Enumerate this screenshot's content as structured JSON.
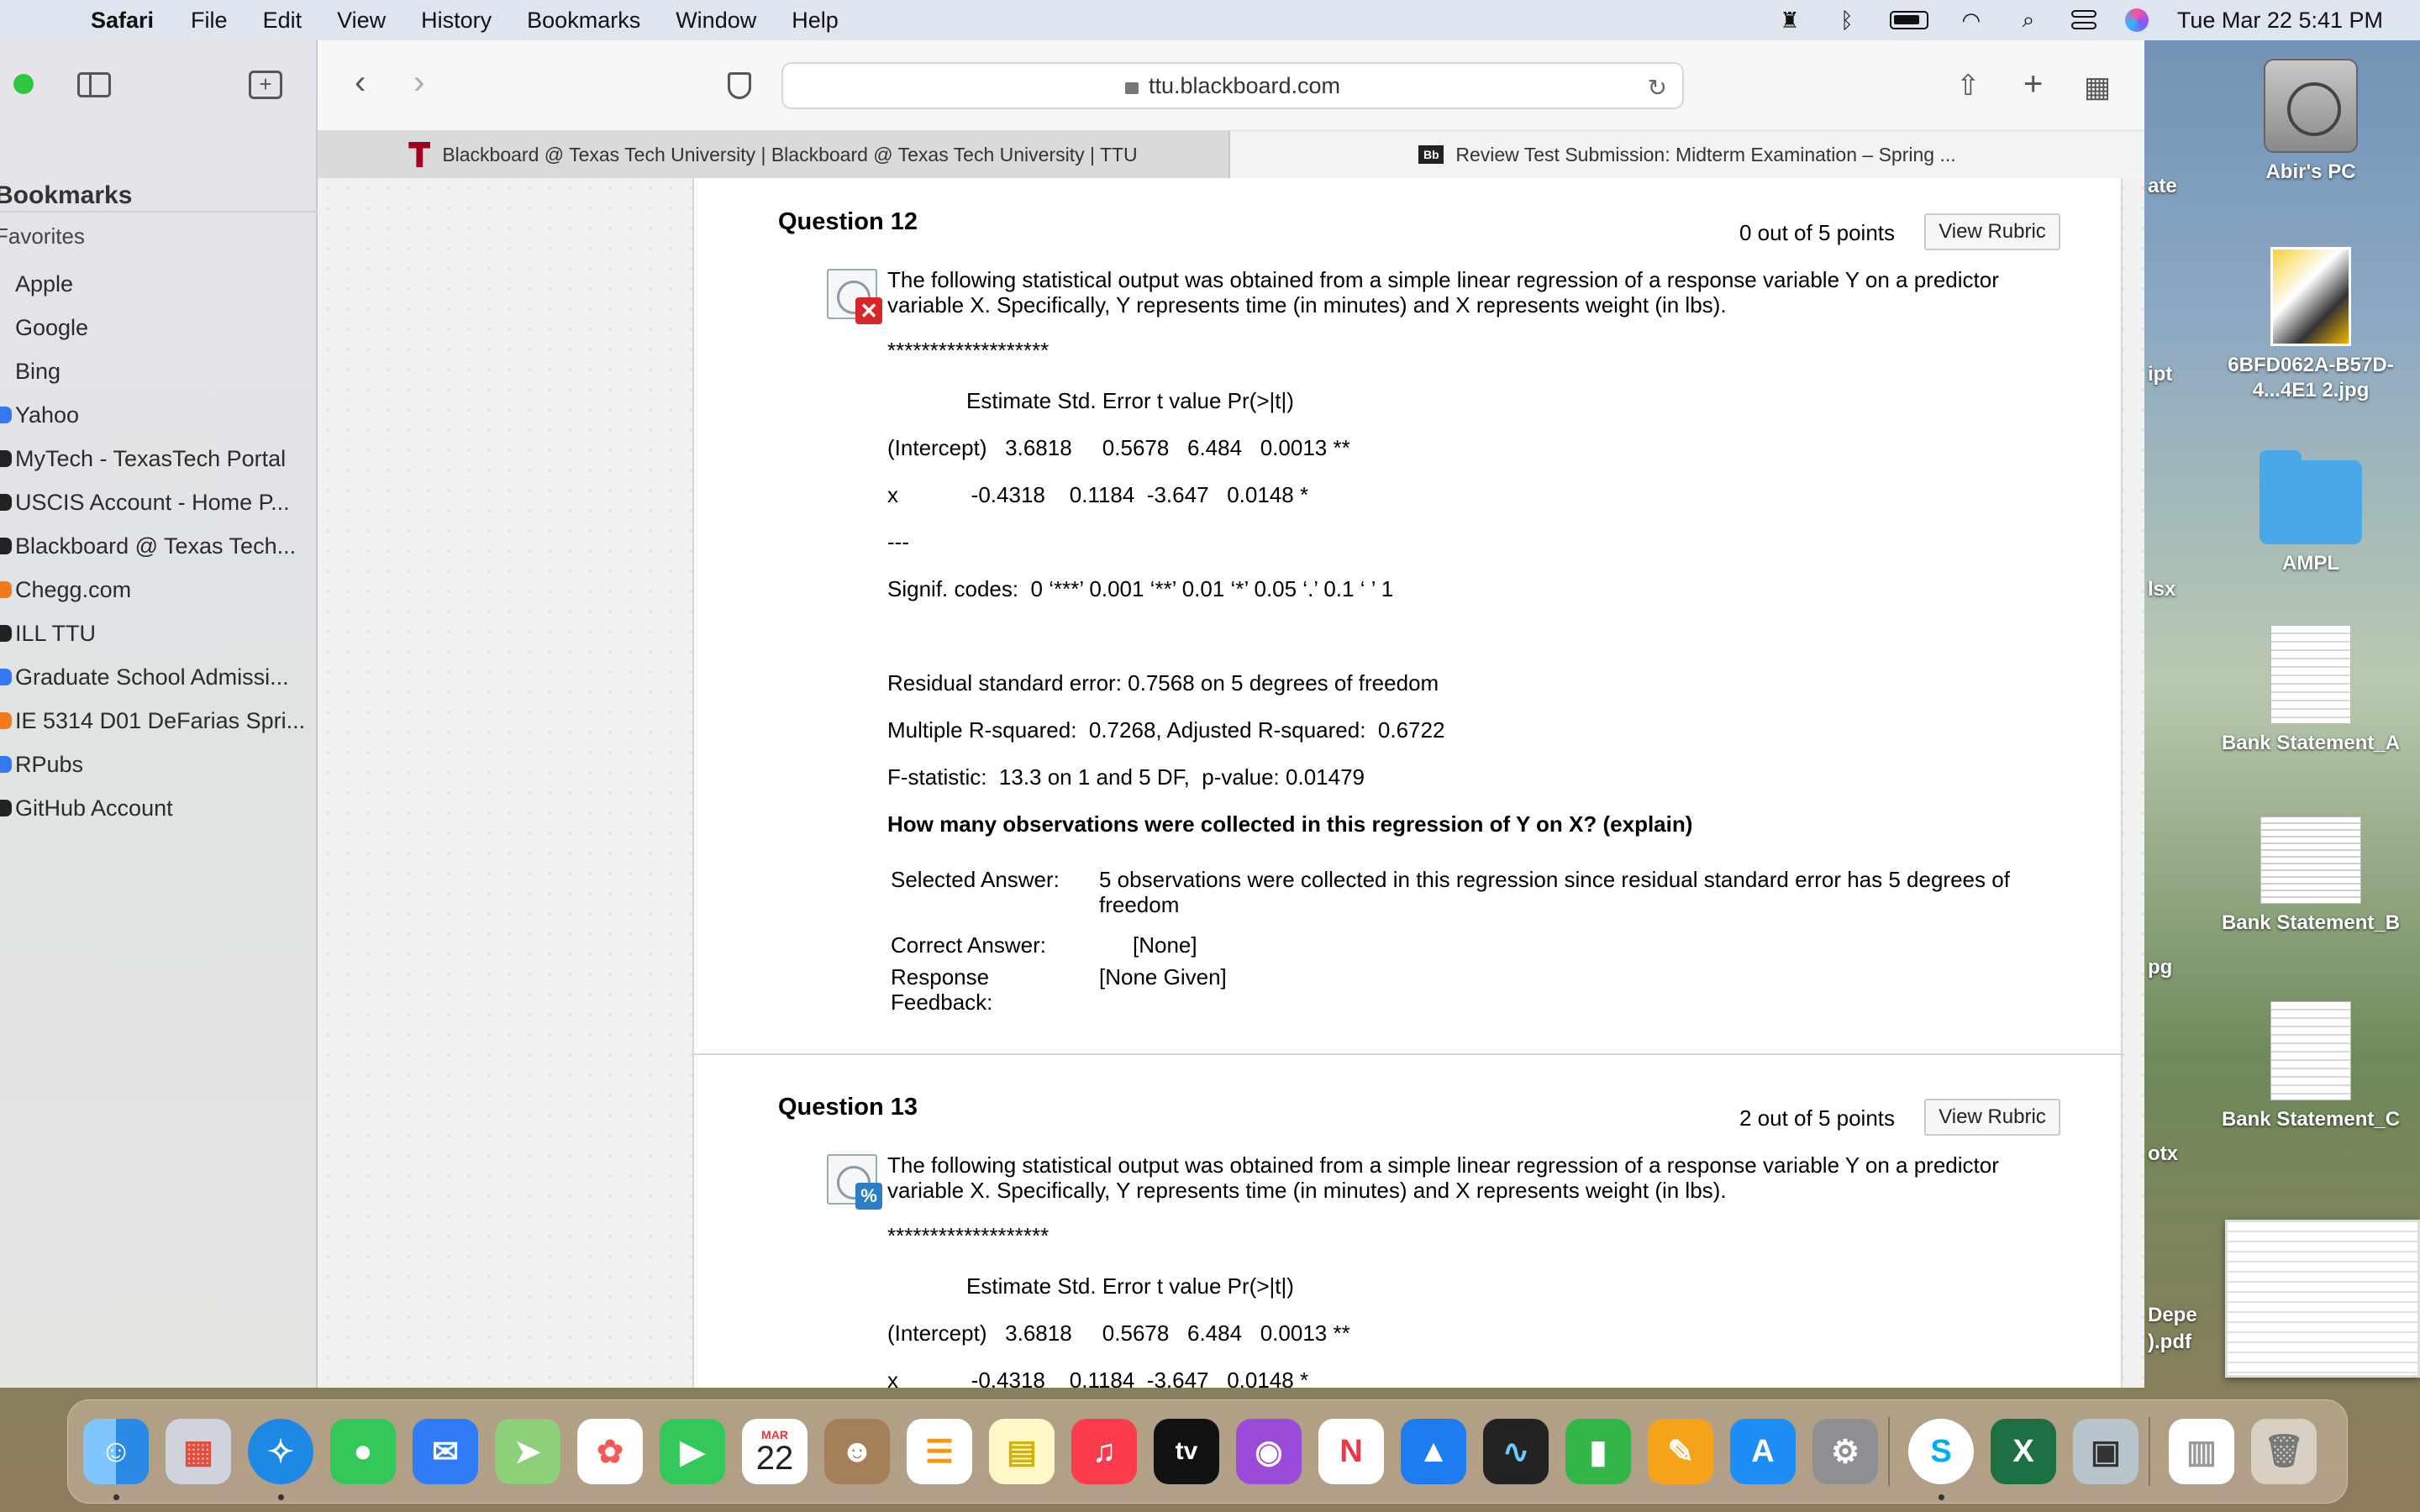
{
  "menubar": {
    "app": "Safari",
    "items": [
      "File",
      "Edit",
      "View",
      "History",
      "Bookmarks",
      "Window",
      "Help"
    ],
    "clock": "Tue Mar 22  5:41 PM"
  },
  "sidebar": {
    "heading": "Bookmarks",
    "favorites_label": "Favorites",
    "items": [
      {
        "label": "Apple",
        "color": ""
      },
      {
        "label": "Google",
        "color": ""
      },
      {
        "label": "Bing",
        "color": ""
      },
      {
        "label": "Yahoo",
        "color": "#3478f6"
      },
      {
        "label": "MyTech - TexasTech Portal",
        "color": "#222222"
      },
      {
        "label": "USCIS Account - Home P...",
        "color": "#222222"
      },
      {
        "label": "Blackboard @ Texas Tech...",
        "color": "#222222"
      },
      {
        "label": "Chegg.com",
        "color": "#f27a1a"
      },
      {
        "label": "ILL TTU",
        "color": "#222222"
      },
      {
        "label": "Graduate School Admissi...",
        "color": "#3478f6"
      },
      {
        "label": "IE 5314 D01 DeFarias Spri...",
        "color": "#f27a1a"
      },
      {
        "label": "RPubs",
        "color": "#3478f6"
      },
      {
        "label": "GitHub Account",
        "color": "#222222"
      }
    ]
  },
  "toolbar": {
    "url": "ttu.blackboard.com"
  },
  "tabs": [
    {
      "label": "Blackboard @ Texas Tech University | Blackboard @ Texas Tech University | TTU"
    },
    {
      "label": "Review Test Submission: Midterm Examination – Spring ...",
      "favicon": "Bb"
    }
  ],
  "q12": {
    "title": "Question 12",
    "points": "0 out of 5 points",
    "rubric": "View Rubric",
    "intro": "The following statistical output was obtained from a simple linear regression of a response variable Y on a predictor variable X.  Specifically, Y represents time (in minutes) and X represents weight (in lbs).",
    "stars": "*******************",
    "header": "Estimate Std. Error t value Pr(>|t|)",
    "row_intercept": "(Intercept)   3.6818     0.5678   6.484   0.0013 **",
    "row_x": "x            -0.4318    0.1184  -3.647   0.0148 *",
    "dashes": "---",
    "signif": "Signif. codes:  0 ‘***’ 0.001 ‘**’ 0.01 ‘*’ 0.05 ‘.’ 0.1 ‘ ’ 1",
    "rse": "Residual standard error: 0.7568 on 5 degrees of freedom",
    "r2": "Multiple R-squared:  0.7268, Adjusted R-squared:  0.6722",
    "fstat": "F-statistic:  13.3 on 1 and 5 DF,  p-value: 0.01479",
    "prompt": "How many observations were collected in this regression of Y on X? (explain)",
    "selected_label": "Selected Answer:",
    "selected_value": "5 observations were collected in this regression since residual standard error has 5 degrees of freedom",
    "correct_label": "Correct Answer:",
    "correct_value": "[None]",
    "feedback_label": "Response Feedback:",
    "feedback_value": "[None Given]"
  },
  "q13": {
    "title": "Question 13",
    "points": "2 out of 5 points",
    "rubric": "View Rubric",
    "intro": "The following statistical output was obtained from a simple linear regression of a response variable Y on a predictor variable X.  Specifically, Y represents time (in minutes) and X represents weight (in lbs).",
    "stars": "*******************",
    "header": "Estimate Std. Error t value Pr(>|t|)",
    "row_intercept": "(Intercept)   3.6818     0.5678   6.484   0.0013 **",
    "row_x": "x            -0.4318    0.1184  -3.647   0.0148 *"
  },
  "desktop": {
    "items": [
      {
        "label": "Abir's PC"
      },
      {
        "label": "6BFD062A-B57D-4...4E1 2.jpg"
      },
      {
        "label": "AMPL"
      },
      {
        "label": "Bank Statement_A"
      },
      {
        "label": "Bank Statement_B"
      },
      {
        "label": "Bank Statement_C"
      }
    ],
    "clipped": [
      "ate",
      "ipt",
      "lsx",
      "pg",
      "otx",
      "Depe",
      ").pdf"
    ]
  },
  "dock": {
    "calendar_month": "MAR",
    "calendar_day": "22",
    "tv_label": "tv"
  }
}
